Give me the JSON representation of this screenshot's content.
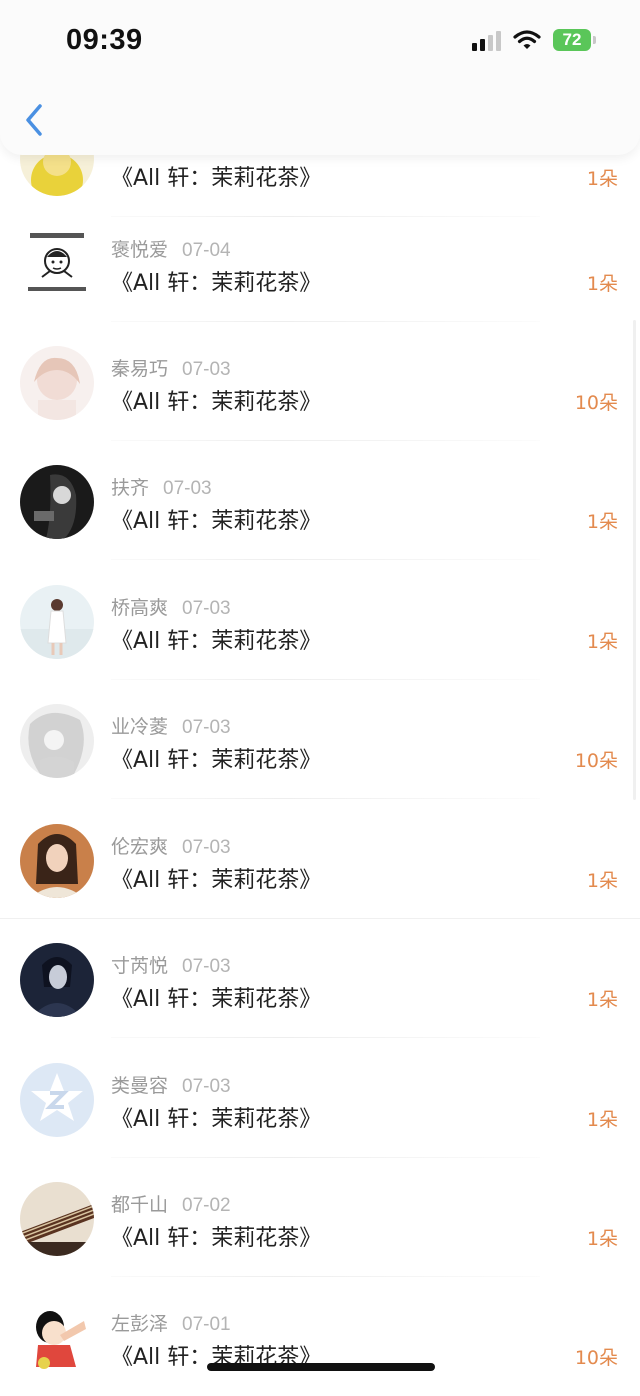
{
  "status_bar": {
    "time": "09:39",
    "battery": "72"
  },
  "nav": {
    "back_icon": "chevron-left-icon",
    "accent": "#4a90e2"
  },
  "colors": {
    "amount": "#e38a4e",
    "name": "#9a9a9a",
    "title": "#222222"
  },
  "items": [
    {
      "name": "",
      "date": "",
      "title": "《All 轩：茉莉花茶》",
      "amount": "1朵"
    },
    {
      "name": "褒悦爱",
      "date": "07-04",
      "title": "《All 轩：茉莉花茶》",
      "amount": "1朵"
    },
    {
      "name": "秦易巧",
      "date": "07-03",
      "title": "《All 轩：茉莉花茶》",
      "amount": "10朵"
    },
    {
      "name": "扶齐",
      "date": "07-03",
      "title": "《All 轩：茉莉花茶》",
      "amount": "1朵"
    },
    {
      "name": "桥高爽",
      "date": "07-03",
      "title": "《All 轩：茉莉花茶》",
      "amount": "1朵"
    },
    {
      "name": "业冷菱",
      "date": "07-03",
      "title": "《All 轩：茉莉花茶》",
      "amount": "10朵"
    },
    {
      "name": "伦宏爽",
      "date": "07-03",
      "title": "《All 轩：茉莉花茶》",
      "amount": "1朵"
    },
    {
      "name": "寸芮悦",
      "date": "07-03",
      "title": "《All 轩：茉莉花茶》",
      "amount": "1朵"
    },
    {
      "name": "类曼容",
      "date": "07-03",
      "title": "《All 轩：茉莉花茶》",
      "amount": "1朵"
    },
    {
      "name": "都千山",
      "date": "07-02",
      "title": "《All 轩：茉莉花茶》",
      "amount": "1朵"
    },
    {
      "name": "左彭泽",
      "date": "07-01",
      "title": "《All 轩：茉莉花茶》",
      "amount": "10朵"
    }
  ]
}
